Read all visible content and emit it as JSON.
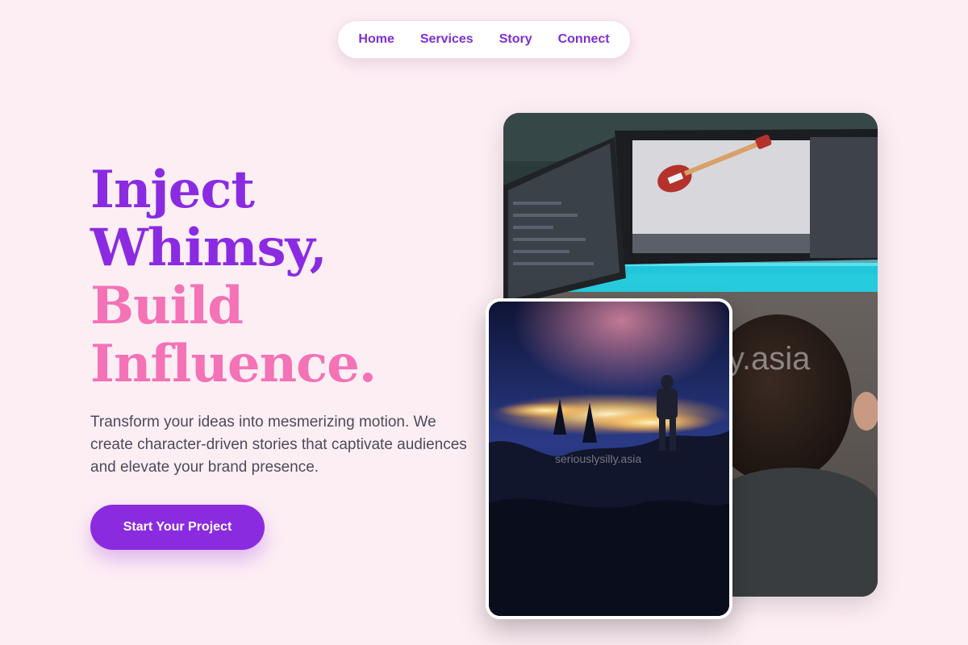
{
  "nav": {
    "items": [
      "Home",
      "Services",
      "Story",
      "Connect"
    ]
  },
  "hero": {
    "line1": "Inject",
    "line2": "Whimsy,",
    "line3": "Build",
    "line4": "Influence.",
    "description": "Transform your ideas into mesmerizing motion. We create character-driven stories that captivate audiences and elevate your brand presence.",
    "cta_label": "Start Your Project"
  },
  "images": {
    "main_watermark": "ly.asia",
    "small_watermark": "seriouslysilly.asia"
  },
  "colors": {
    "background": "#fdeef4",
    "accent_purple": "#8a2be2",
    "accent_pink": "#f472b6",
    "nav_text": "#7e2fd6"
  }
}
